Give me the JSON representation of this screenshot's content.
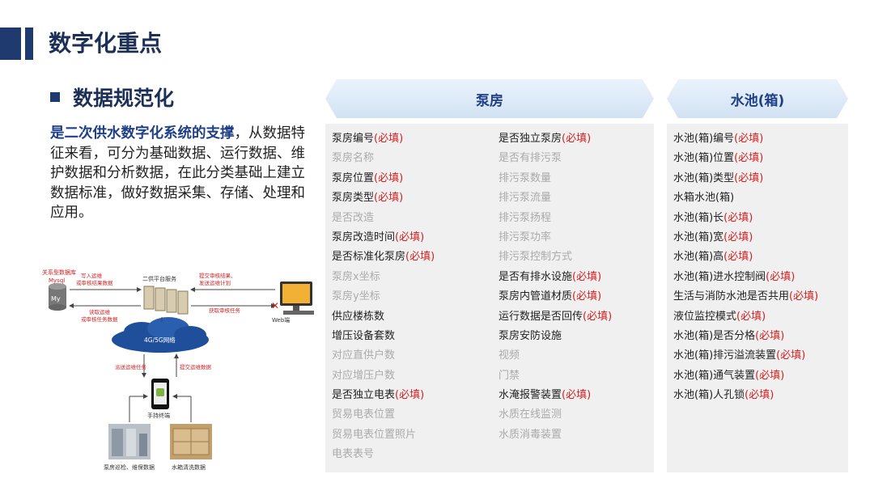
{
  "slide": {
    "title": "数字化重点",
    "subtitle": "数据规范化",
    "intro_bold": "是二次供水数字化系统的支撑",
    "intro_rest": "，从数据特征来看，可分为基础数据、运行数据、维护数据和分析数据，在此分类基础上建立数据标准，做好数据采集、存储、处理和应用。"
  },
  "colors": {
    "title": "#1c2f57",
    "accent": "#1f3f86",
    "required": "#d21f1f",
    "inactive": "#aaaaaa",
    "panel": "#f0f0f0"
  },
  "diagram": {
    "db_label": [
      "关系型数据库",
      "Mysql"
    ],
    "server_label": "二供平台服务",
    "write_label": [
      "写入运维",
      "或审核结果数据"
    ],
    "read_label": [
      "读取运维",
      "或审核任务数据"
    ],
    "submit_label": [
      "提交审核结果、",
      "发送运维计划"
    ],
    "fetch_label": "获取审核任务",
    "cloud_label": "4G/5G网络",
    "web_label": "Web端",
    "dispatch_label": "派送运维任务",
    "upload_label": "提交运维数据",
    "phone_label": "手持终端",
    "photo1_label": "泵房巡检、维保数据",
    "photo2_label": "水箱清洗数据"
  },
  "pump_room": {
    "header": "泵房",
    "col1": [
      {
        "label": "泵房编号",
        "req": "(必填)",
        "active": true
      },
      {
        "label": "泵房名称",
        "req": "",
        "active": false
      },
      {
        "label": "泵房位置",
        "req": "(必填)",
        "active": true
      },
      {
        "label": "泵房类型",
        "req": "(必填)",
        "active": true
      },
      {
        "label": "是否改造",
        "req": "",
        "active": false
      },
      {
        "label": "泵房改造时间",
        "req": "(必填)",
        "active": true
      },
      {
        "label": "是否标准化泵房",
        "req": "(必填)",
        "active": true
      },
      {
        "label": "泵房x坐标",
        "req": "",
        "active": false
      },
      {
        "label": "泵房y坐标",
        "req": "",
        "active": false
      },
      {
        "label": "供应楼栋数",
        "req": "",
        "active": true
      },
      {
        "label": "增压设备套数",
        "req": "",
        "active": true
      },
      {
        "label": "对应直供户数",
        "req": "",
        "active": false
      },
      {
        "label": "对应增压户数",
        "req": "",
        "active": false
      },
      {
        "label": "是否独立电表",
        "req": "(必填)",
        "active": true
      },
      {
        "label": "贸易电表位置",
        "req": "",
        "active": false
      },
      {
        "label": "贸易电表位置照片",
        "req": "",
        "active": false
      },
      {
        "label": "电表表号",
        "req": "",
        "active": false
      }
    ],
    "col2": [
      {
        "label": "是否独立泵房",
        "req": "(必填)",
        "active": true
      },
      {
        "label": "是否有排污泵",
        "req": "",
        "active": false
      },
      {
        "label": "排污泵数量",
        "req": "",
        "active": false
      },
      {
        "label": "排污泵流量",
        "req": "",
        "active": false
      },
      {
        "label": "排污泵扬程",
        "req": "",
        "active": false
      },
      {
        "label": "排污泵功率",
        "req": "",
        "active": false
      },
      {
        "label": "排污泵控制方式",
        "req": "",
        "active": false
      },
      {
        "label": "是否有排水设施",
        "req": "(必填)",
        "active": true
      },
      {
        "label": "泵房内管道材质",
        "req": "(必填)",
        "active": true
      },
      {
        "label": "运行数据是否回传",
        "req": "(必填)",
        "active": true
      },
      {
        "label": "泵房安防设施",
        "req": "",
        "active": true
      },
      {
        "label": "视频",
        "req": "",
        "active": false
      },
      {
        "label": "门禁",
        "req": "",
        "active": false
      },
      {
        "label": "水淹报警装置",
        "req": "(必填)",
        "active": true
      },
      {
        "label": "水质在线监测",
        "req": "",
        "active": false
      },
      {
        "label": "水质消毒装置",
        "req": "",
        "active": false
      }
    ]
  },
  "water_tank": {
    "header": "水池(箱)",
    "col1": [
      {
        "label": "水池(箱)编号",
        "req": "(必填)",
        "active": true
      },
      {
        "label": "水池(箱)位置",
        "req": "(必填)",
        "active": true
      },
      {
        "label": "水池(箱)类型",
        "req": "(必填)",
        "active": true
      },
      {
        "label": "水箱水池(箱)",
        "req": "",
        "active": true
      },
      {
        "label": "水池(箱)长",
        "req": "(必填)",
        "active": true
      },
      {
        "label": "水池(箱)宽",
        "req": "(必填)",
        "active": true
      },
      {
        "label": "水池(箱)高",
        "req": "(必填)",
        "active": true
      },
      {
        "label": "水池(箱)进水控制阀",
        "req": "(必填)",
        "active": true
      },
      {
        "label": "生活与消防水池是否共用",
        "req": "(必填)",
        "active": true
      },
      {
        "label": "液位监控模式",
        "req": "(必填)",
        "active": true
      },
      {
        "label": "水池(箱)是否分格",
        "req": "(必填)",
        "active": true
      },
      {
        "label": "水池(箱)排污溢流装置",
        "req": "(必填)",
        "active": true
      },
      {
        "label": "水池(箱)通气装置",
        "req": "(必填)",
        "active": true
      },
      {
        "label": "水池(箱)人孔锁",
        "req": "(必填)",
        "active": true
      }
    ]
  }
}
